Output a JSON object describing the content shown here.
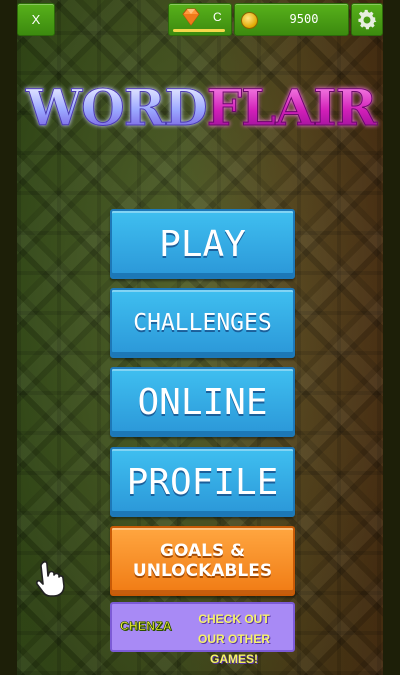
{
  "top_bar": {
    "close_label": "X",
    "gems_value": "C",
    "coins_value": "9500"
  },
  "logo": {
    "word1": "WORD",
    "word2": "FLAIR"
  },
  "menu": {
    "play": "PLAY",
    "challenges": "CHALLENGES",
    "online": "ONLINE",
    "profile": "PROFILE",
    "goals_line1": "GOALS &",
    "goals_line2": "UNLOCKABLES",
    "chenza_logo": "CHENZA",
    "chenza_line1": "CHECK OUT",
    "chenza_line2": "OUR OTHER GAMES!"
  },
  "icons": {
    "gem": "gem-icon",
    "coin": "coin-icon",
    "settings": "gear-icon",
    "pointer": "hand-pointer-icon"
  },
  "colors": {
    "top_green": "#4a9e16",
    "button_blue": "#35aee6",
    "button_orange": "#f58a22",
    "chenza_purple": "#a88af5",
    "logo_blue": "#9aa6ff",
    "logo_pink": "#d11fb8"
  }
}
